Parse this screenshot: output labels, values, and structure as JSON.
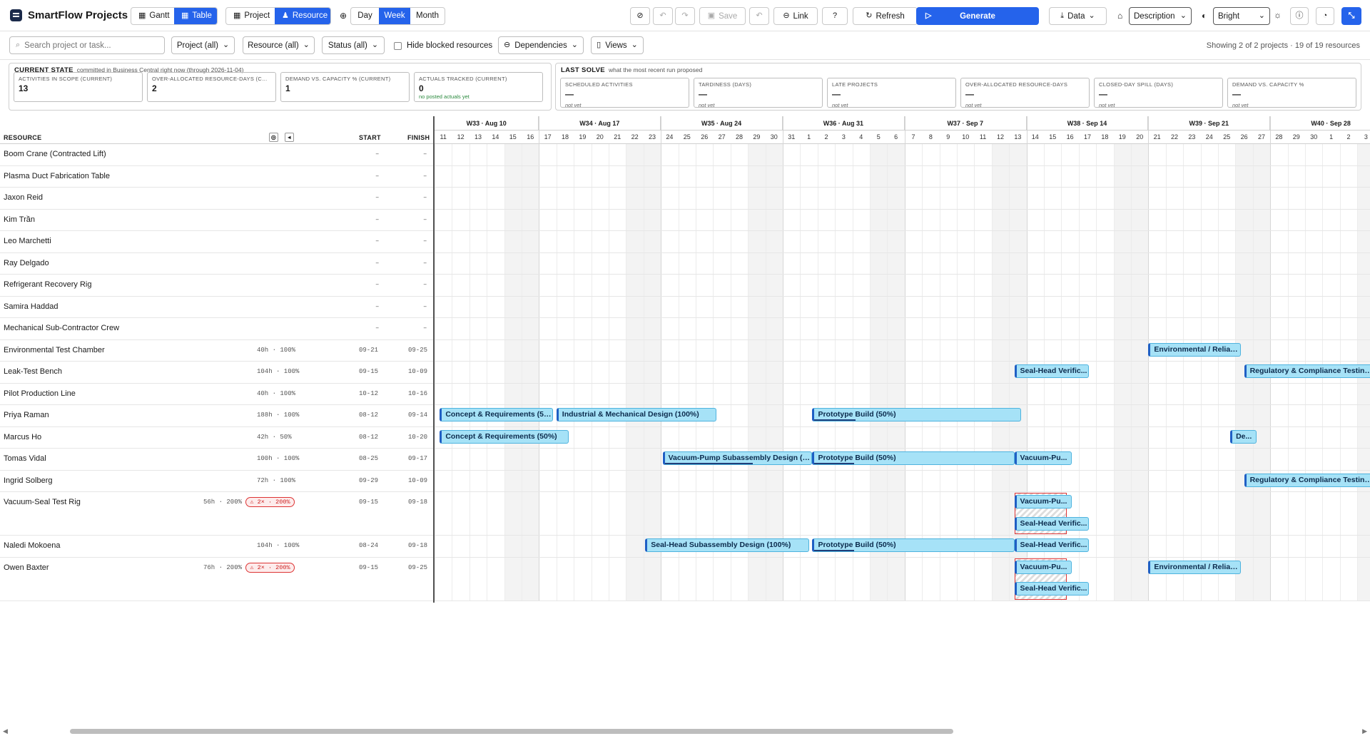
{
  "app": {
    "title": "SmartFlow Projects"
  },
  "toolbar": {
    "view_mode": [
      {
        "label": "Gantt",
        "active": false
      },
      {
        "label": "Table",
        "active": true
      }
    ],
    "group_mode": [
      {
        "label": "Project",
        "active": false
      },
      {
        "label": "Resource",
        "active": true
      }
    ],
    "scale": [
      {
        "label": "Day",
        "active": false
      },
      {
        "label": "Week",
        "active": true
      },
      {
        "label": "Month",
        "active": false
      }
    ],
    "save_label": "Save",
    "link_label": "Link",
    "refresh_label": "Refresh",
    "generate_label": "Generate",
    "data_label": "Data",
    "label_select": "Description",
    "theme_select": "Bright"
  },
  "filters": {
    "search_placeholder": "Search project or task...",
    "project": "Project (all)",
    "resource": "Resource (all)",
    "status": "Status (all)",
    "hide_blocked": "Hide blocked resources",
    "dependencies": "Dependencies",
    "views": "Views",
    "showing": "Showing 2 of 2 projects · 19 of 19 resources"
  },
  "current_state": {
    "title": "CURRENT STATE",
    "subtitle": "committed in Business Central right now (through 2026-11-04)",
    "cards": [
      {
        "label": "ACTIVITIES IN SCOPE (CURRENT)",
        "value": "13",
        "sub": ""
      },
      {
        "label": "OVER-ALLOCATED RESOURCE-DAYS (CURRENT)",
        "value": "2",
        "sub": ""
      },
      {
        "label": "DEMAND VS. CAPACITY % (CURRENT)",
        "value": "1",
        "sub": ""
      },
      {
        "label": "ACTUALS TRACKED (CURRENT)",
        "value": "0",
        "sub": "no posted actuals yet"
      }
    ]
  },
  "last_solve": {
    "title": "LAST SOLVE",
    "subtitle": "what the most recent run proposed",
    "cards": [
      {
        "label": "SCHEDULED ACTIVITIES",
        "value": "—",
        "sub": "not yet"
      },
      {
        "label": "TARDINESS (DAYS)",
        "value": "—",
        "sub": "not yet"
      },
      {
        "label": "LATE PROJECTS",
        "value": "—",
        "sub": "not yet"
      },
      {
        "label": "OVER-ALLOCATED RESOURCE-DAYS",
        "value": "—",
        "sub": "not yet"
      },
      {
        "label": "CLOSED-DAY SPILL (DAYS)",
        "value": "—",
        "sub": "not yet"
      },
      {
        "label": "DEMAND VS. CAPACITY %",
        "value": "—",
        "sub": "not yet"
      }
    ]
  },
  "table": {
    "headers": {
      "resource": "RESOURCE",
      "start": "START",
      "finish": "FINISH"
    },
    "rows": [
      {
        "name": "Boom Crane (Contracted Lift)",
        "util": "",
        "badge": "",
        "start": "–",
        "finish": "–",
        "lanes": 1
      },
      {
        "name": "Plasma Duct Fabrication Table",
        "util": "",
        "badge": "",
        "start": "–",
        "finish": "–",
        "lanes": 1
      },
      {
        "name": "Jaxon Reid",
        "util": "",
        "badge": "",
        "start": "–",
        "finish": "–",
        "lanes": 1
      },
      {
        "name": "Kim Trần",
        "util": "",
        "badge": "",
        "start": "–",
        "finish": "–",
        "lanes": 1
      },
      {
        "name": "Leo Marchetti",
        "util": "",
        "badge": "",
        "start": "–",
        "finish": "–",
        "lanes": 1
      },
      {
        "name": "Ray Delgado",
        "util": "",
        "badge": "",
        "start": "–",
        "finish": "–",
        "lanes": 1
      },
      {
        "name": "Refrigerant Recovery Rig",
        "util": "",
        "badge": "",
        "start": "–",
        "finish": "–",
        "lanes": 1
      },
      {
        "name": "Samira Haddad",
        "util": "",
        "badge": "",
        "start": "–",
        "finish": "–",
        "lanes": 1
      },
      {
        "name": "Mechanical Sub-Contractor Crew",
        "util": "",
        "badge": "",
        "start": "–",
        "finish": "–",
        "lanes": 1
      },
      {
        "name": "Environmental Test Chamber",
        "util": "40h · 100%",
        "badge": "",
        "start": "09-21",
        "finish": "09-25",
        "lanes": 1
      },
      {
        "name": "Leak-Test Bench",
        "util": "104h · 100%",
        "badge": "",
        "start": "09-15",
        "finish": "10-09",
        "lanes": 1
      },
      {
        "name": "Pilot Production Line",
        "util": "40h · 100%",
        "badge": "",
        "start": "10-12",
        "finish": "10-16",
        "lanes": 1
      },
      {
        "name": "Priya Raman",
        "util": "188h · 100%",
        "badge": "",
        "start": "08-12",
        "finish": "09-14",
        "lanes": 1
      },
      {
        "name": "Marcus Ho",
        "util": "42h · 50%",
        "badge": "",
        "start": "08-12",
        "finish": "10-20",
        "lanes": 1
      },
      {
        "name": "Tomas Vidal",
        "util": "100h · 100%",
        "badge": "",
        "start": "08-25",
        "finish": "09-17",
        "lanes": 1
      },
      {
        "name": "Ingrid Solberg",
        "util": "72h · 100%",
        "badge": "",
        "start": "09-29",
        "finish": "10-09",
        "lanes": 1
      },
      {
        "name": "Vacuum-Seal Test Rig",
        "util": "56h · 200%",
        "badge": "⚠ 2× · 200%",
        "start": "09-15",
        "finish": "09-18",
        "lanes": 2
      },
      {
        "name": "Naledi Mokoena",
        "util": "104h · 100%",
        "badge": "",
        "start": "08-24",
        "finish": "09-18",
        "lanes": 1
      },
      {
        "name": "Owen Baxter",
        "util": "76h · 200%",
        "badge": "⚠ 2× · 200%",
        "start": "09-15",
        "finish": "09-25",
        "lanes": 2
      }
    ]
  },
  "timeline": {
    "first_day": "Aug 11",
    "weeks": [
      "W33 · Aug 10",
      "W34 · Aug 17",
      "W35 · Aug 24",
      "W36 · Aug 31",
      "W37 · Sep 7",
      "W38 · Sep 14",
      "W39 · Sep 21",
      "W40 · Sep 28"
    ],
    "days": [
      "11",
      "12",
      "13",
      "14",
      "15",
      "16",
      "17",
      "18",
      "19",
      "20",
      "21",
      "22",
      "23",
      "24",
      "25",
      "26",
      "27",
      "28",
      "29",
      "30",
      "31",
      "1",
      "2",
      "3",
      "4",
      "5",
      "6",
      "7",
      "8",
      "9",
      "10",
      "11",
      "12",
      "13",
      "14",
      "15",
      "16",
      "17",
      "18",
      "19",
      "20",
      "21",
      "22",
      "23",
      "24",
      "25",
      "26",
      "27",
      "28",
      "29",
      "30",
      "1",
      "2",
      "3"
    ]
  },
  "bars": [
    {
      "row": 9,
      "lane": 0,
      "start": 41,
      "end": 46.3,
      "label": "Environmental / Reliab...",
      "progress": 0
    },
    {
      "row": 10,
      "lane": 0,
      "start": 33.3,
      "end": 37.6,
      "label": "Seal-Head Verific...",
      "progress": 0
    },
    {
      "row": 10,
      "lane": 0,
      "start": 46.5,
      "end": 54,
      "label": "Regulatory & Compliance Testing (I",
      "progress": 0
    },
    {
      "row": 12,
      "lane": 0,
      "start": 0.3,
      "end": 6.8,
      "label": "Concept & Requirements (50%)",
      "progress": 0
    },
    {
      "row": 12,
      "lane": 0,
      "start": 7.0,
      "end": 16.2,
      "label": "Industrial & Mechanical Design (100%)",
      "progress": 0
    },
    {
      "row": 12,
      "lane": 0,
      "start": 21.7,
      "end": 33.7,
      "label": "Prototype Build (50%)",
      "progress": 0.2
    },
    {
      "row": 13,
      "lane": 0,
      "start": 0.3,
      "end": 7.7,
      "label": "Concept & Requirements (50%)",
      "progress": 0
    },
    {
      "row": 13,
      "lane": 0,
      "start": 45.7,
      "end": 47.2,
      "label": "De...",
      "progress": 0
    },
    {
      "row": 14,
      "lane": 0,
      "start": 13.1,
      "end": 21.7,
      "label": "Vacuum-Pump Subassembly Design (100...",
      "progress": 0.6
    },
    {
      "row": 14,
      "lane": 0,
      "start": 21.7,
      "end": 33.3,
      "label": "Prototype Build (50%)",
      "progress": 0.2
    },
    {
      "row": 14,
      "lane": 0,
      "start": 33.3,
      "end": 36.6,
      "label": "Vacuum-Pu...",
      "progress": 0
    },
    {
      "row": 15,
      "lane": 0,
      "start": 46.5,
      "end": 54,
      "label": "Regulatory & Compliance Testing (I",
      "progress": 0
    },
    {
      "row": 16,
      "lane": 0,
      "start": 33.3,
      "end": 36.6,
      "label": "Vacuum-Pu...",
      "progress": 0
    },
    {
      "row": 16,
      "lane": 1,
      "start": 33.3,
      "end": 37.6,
      "label": "Seal-Head Verific...",
      "progress": 0
    },
    {
      "row": 17,
      "lane": 0,
      "start": 12.1,
      "end": 21.5,
      "label": "Seal-Head Subassembly Design (100%)",
      "progress": 0
    },
    {
      "row": 17,
      "lane": 0,
      "start": 21.7,
      "end": 33.3,
      "label": "Prototype Build (50%)",
      "progress": 0.2
    },
    {
      "row": 17,
      "lane": 0,
      "start": 33.3,
      "end": 37.6,
      "label": "Seal-Head Verific...",
      "progress": 0
    },
    {
      "row": 18,
      "lane": 0,
      "start": 33.3,
      "end": 36.6,
      "label": "Vacuum-Pu...",
      "progress": 0
    },
    {
      "row": 18,
      "lane": 0,
      "start": 41,
      "end": 46.3,
      "label": "Environmental / Reliab...",
      "progress": 0
    },
    {
      "row": 18,
      "lane": 1,
      "start": 33.3,
      "end": 37.6,
      "label": "Seal-Head Verific...",
      "progress": 0
    }
  ],
  "conflicts": [
    {
      "row": 16,
      "start": 33.3,
      "end": 36.3
    },
    {
      "row": 18,
      "start": 33.3,
      "end": 36.3
    }
  ],
  "colors": {
    "accent": "#2563eb",
    "bar_fill": "#a6e2f7",
    "bar_edge": "#1f5fc4",
    "conflict": "#dd3333"
  }
}
